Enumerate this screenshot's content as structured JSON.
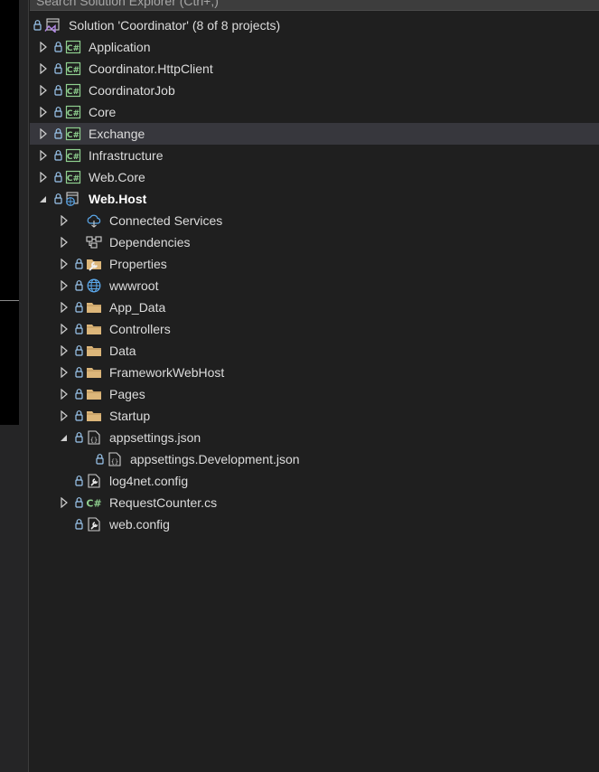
{
  "search": {
    "placeholder": "Search Solution Explorer (Ctrl+;)"
  },
  "solution": {
    "label": "Solution 'Coordinator' (8 of 8 projects)"
  },
  "projects": [
    {
      "label": "Application"
    },
    {
      "label": "Coordinator.HttpClient"
    },
    {
      "label": "CoordinatorJob"
    },
    {
      "label": "Core"
    },
    {
      "label": "Exchange"
    },
    {
      "label": "Infrastructure"
    },
    {
      "label": "Web.Core"
    },
    {
      "label": "Web.Host"
    }
  ],
  "webhost_items": [
    {
      "label": "Connected Services",
      "icon": "connected-services-icon"
    },
    {
      "label": "Dependencies",
      "icon": "dependencies-icon"
    },
    {
      "label": "Properties",
      "icon": "properties-folder-icon"
    },
    {
      "label": "wwwroot",
      "icon": "globe-icon"
    },
    {
      "label": "App_Data",
      "icon": "folder-icon"
    },
    {
      "label": "Controllers",
      "icon": "folder-icon"
    },
    {
      "label": "Data",
      "icon": "folder-icon"
    },
    {
      "label": "FrameworkWebHost",
      "icon": "folder-icon"
    },
    {
      "label": "Pages",
      "icon": "folder-icon"
    },
    {
      "label": "Startup",
      "icon": "folder-icon"
    },
    {
      "label": "appsettings.json",
      "icon": "json-file-icon"
    },
    {
      "label": "appsettings.Development.json",
      "icon": "json-file-icon"
    },
    {
      "label": "log4net.config",
      "icon": "config-file-icon"
    },
    {
      "label": "RequestCounter.cs",
      "icon": "csharp-file-icon"
    },
    {
      "label": "web.config",
      "icon": "config-file-icon"
    }
  ],
  "colors": {
    "background": "#1f1f1f",
    "selected_row": "#37373d",
    "lock": "#9cc8f0",
    "csharp_green": "#8fd08f",
    "folder": "#dcb67a"
  }
}
